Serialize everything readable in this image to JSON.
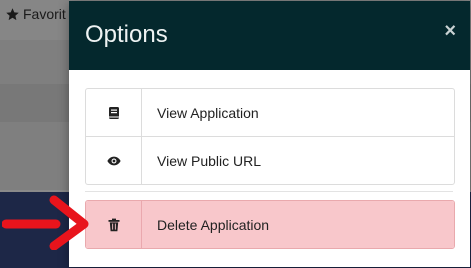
{
  "background": {
    "favorites_label": "Favorit"
  },
  "modal": {
    "title": "Options",
    "close_symbol": "×",
    "options": [
      {
        "label": "View Application",
        "icon": "book-icon"
      },
      {
        "label": "View Public URL",
        "icon": "eye-icon"
      }
    ],
    "danger_option": {
      "label": "Delete Application",
      "icon": "trash-icon"
    }
  },
  "colors": {
    "header_bg": "#04282d",
    "danger_bg": "#f8c7cb",
    "arrow": "#e8141c"
  }
}
